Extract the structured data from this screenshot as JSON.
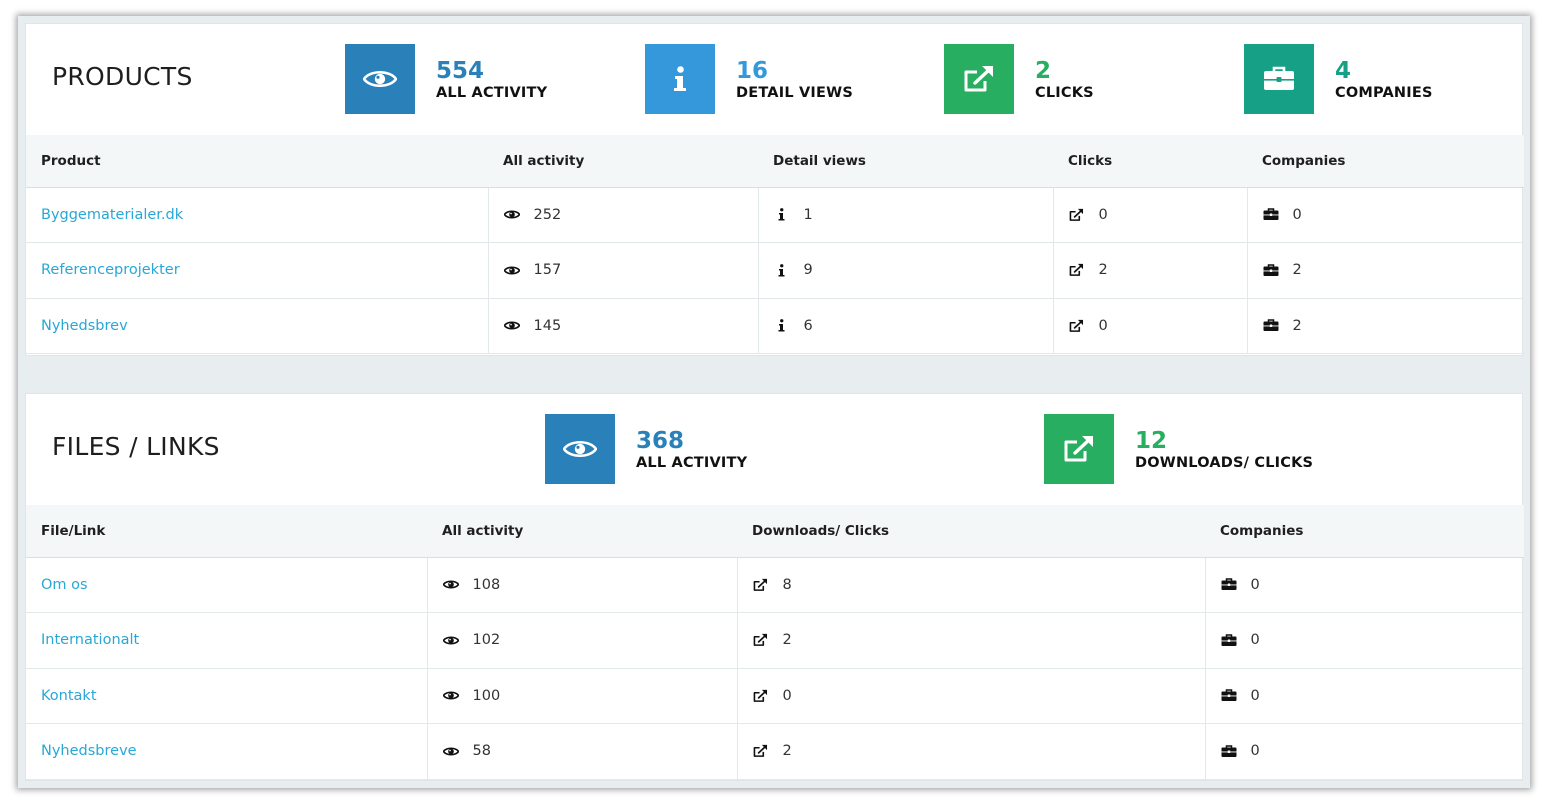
{
  "products": {
    "title": "PRODUCTS",
    "stats": [
      {
        "value": "554",
        "label": "ALL ACTIVITY",
        "icon": "eye-icon",
        "color": "#2a80b9"
      },
      {
        "value": "16",
        "label": "DETAIL VIEWS",
        "icon": "info-icon",
        "color": "#3498db"
      },
      {
        "value": "2",
        "label": "CLICKS",
        "icon": "external-link-icon",
        "color": "#27ae60"
      },
      {
        "value": "4",
        "label": "COMPANIES",
        "icon": "briefcase-icon",
        "color": "#16a085"
      }
    ],
    "columns": [
      "Product",
      "All activity",
      "Detail views",
      "Clicks",
      "Companies"
    ],
    "rows": [
      {
        "name": "Byggematerialer.dk",
        "activity": "252",
        "views": "1",
        "clicks": "0",
        "companies": "0"
      },
      {
        "name": "Referenceprojekter",
        "activity": "157",
        "views": "9",
        "clicks": "2",
        "companies": "2"
      },
      {
        "name": "Nyhedsbrev",
        "activity": "145",
        "views": "6",
        "clicks": "0",
        "companies": "2"
      }
    ]
  },
  "files": {
    "title": "FILES / LINKS",
    "stats": [
      {
        "value": "368",
        "label": "ALL ACTIVITY",
        "icon": "eye-icon",
        "color": "#2a80b9"
      },
      {
        "value": "12",
        "label": "DOWNLOADS/ CLICKS",
        "icon": "external-link-icon",
        "color": "#27ae60"
      }
    ],
    "columns": [
      "File/Link",
      "All activity",
      "Downloads/ Clicks",
      "Companies"
    ],
    "rows": [
      {
        "name": "Om os",
        "activity": "108",
        "clicks": "8",
        "companies": "0"
      },
      {
        "name": "Internationalt",
        "activity": "102",
        "clicks": "2",
        "companies": "0"
      },
      {
        "name": "Kontakt",
        "activity": "100",
        "clicks": "0",
        "companies": "0"
      },
      {
        "name": "Nyhedsbreve",
        "activity": "58",
        "clicks": "2",
        "companies": "0"
      }
    ]
  }
}
